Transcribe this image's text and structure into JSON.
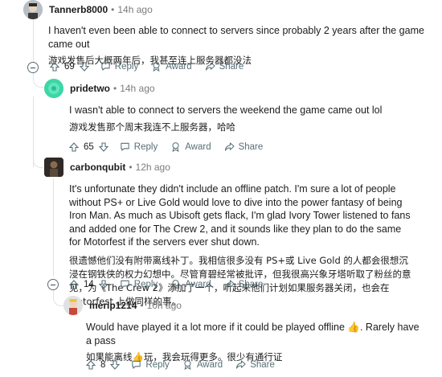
{
  "comments": [
    {
      "username": "Tannerb8000",
      "separator": "•",
      "time": "14h ago",
      "text_en": "I haven't even been able to connect to servers since probably 2 years after the game came out",
      "text_cn": "游戏发售后大概两年后，我甚至连上服务器都没法",
      "votes": "69",
      "reply_label": "Reply",
      "award_label": "Award",
      "share_label": "Share",
      "avatar_color": "#c9cdd1"
    },
    {
      "username": "pridetwo",
      "separator": "•",
      "time": "14h ago",
      "text_en": "I wasn't able to connect to servers the weekend the game came out lol",
      "text_cn": "游戏发售那个周末我连不上服务器，哈哈",
      "votes": "65",
      "reply_label": "Reply",
      "award_label": "Award",
      "share_label": "Share",
      "avatar_color": "#3fd6a6"
    },
    {
      "username": "carbonqubit",
      "separator": "•",
      "time": "12h ago",
      "text_en": "It's unfortunate they didn't include an offline patch. I'm sure a lot of people without PS+ or Live Gold would love to dive into the power fantasy of being Iron Man. As much as Ubisoft gets flack, I'm glad Ivory Tower listened to fans and added one for The Crew 2, and it sounds like they plan to do the same for Motorfest if the servers ever shut down.",
      "text_cn": "很遗憾他们没有附带离线补丁。我相信很多没有 PS+或 Live Gold 的人都会很想沉浸在钢铁侠的权力幻想中。尽管育碧经常被批评，但我很高兴象牙塔听取了粉丝的意见，为《The Crew 2》添加了一个，听起来他们计划如果服务器关闭，也会在 Motorfest 上做同样的事。",
      "votes": "14",
      "reply_label": "Reply",
      "award_label": "Award",
      "share_label": "Share",
      "avatar_color": "#3a3330"
    },
    {
      "username": "merip1214",
      "separator": "•",
      "time": "10h ago",
      "text_en": "Would have played it a lot more if it could be played offline 👍. Rarely have a pass",
      "text_cn": "如果能离线👍玩，我会玩得更多。很少有通行证",
      "votes": "8",
      "reply_label": "Reply",
      "award_label": "Award",
      "share_label": "Share",
      "avatar_color": "#d7dadd"
    }
  ]
}
